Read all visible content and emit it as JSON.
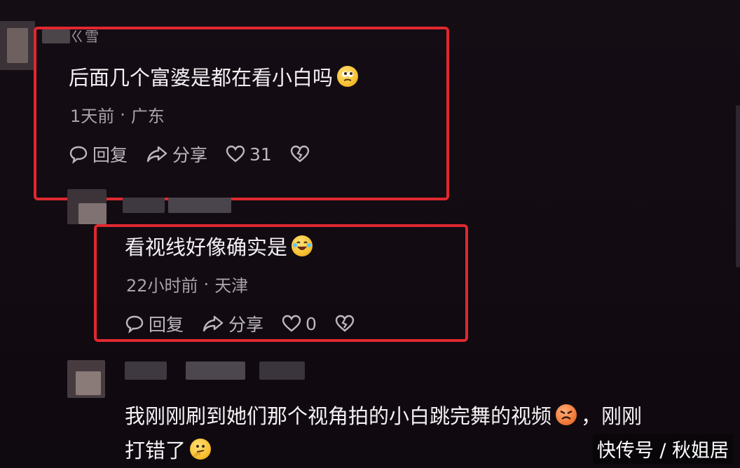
{
  "comments": [
    {
      "username": "ㄍ雪",
      "text": "后面几个富婆是都在看小白吗",
      "emoji": "thinking-eyes-emoji",
      "time": "1天前",
      "separator": "·",
      "location": "广东",
      "reply_label": "回复",
      "share_label": "分享",
      "like_count": "31"
    },
    {
      "username": "",
      "text": "看视线好像确实是",
      "emoji": "laughing-tears-emoji",
      "time": "22小时前",
      "separator": "·",
      "location": "天津",
      "reply_label": "回复",
      "share_label": "分享",
      "like_count": "0"
    },
    {
      "username": "",
      "text_line1": "我刚刚刷到她们那个视角拍的小白跳完舞的视频",
      "emoji_mid": "angry-emoji",
      "text_line1_end": "，刚刚",
      "text_line2": "打错了",
      "emoji_end": "thinking-emoji"
    }
  ],
  "watermark": "快传号 / 秋姐居",
  "colors": {
    "highlight_border": "#e0282f",
    "background": "#140d13"
  }
}
